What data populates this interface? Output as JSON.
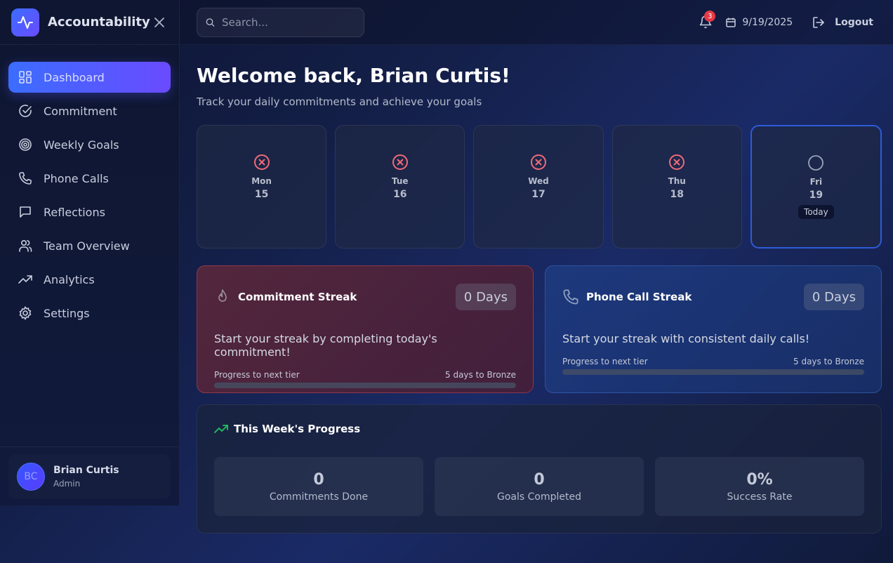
{
  "app": {
    "name": "Accountability"
  },
  "sidebar": {
    "items": [
      {
        "label": "Dashboard",
        "icon": "dashboard-icon",
        "active": true
      },
      {
        "label": "Commitment",
        "icon": "check-circle-icon"
      },
      {
        "label": "Weekly Goals",
        "icon": "target-icon"
      },
      {
        "label": "Phone Calls",
        "icon": "phone-icon"
      },
      {
        "label": "Reflections",
        "icon": "message-icon"
      },
      {
        "label": "Team Overview",
        "icon": "users-icon"
      },
      {
        "label": "Analytics",
        "icon": "trending-up-icon"
      },
      {
        "label": "Settings",
        "icon": "gear-icon"
      }
    ],
    "user": {
      "initials": "BC",
      "name": "Brian Curtis",
      "role": "Admin"
    }
  },
  "header": {
    "search_placeholder": "Search...",
    "notification_count": "3",
    "date": "9/19/2025",
    "logout_label": "Logout"
  },
  "main": {
    "title": "Welcome back, Brian Curtis!",
    "subtitle": "Track your daily commitments and achieve your goals",
    "days": [
      {
        "name": "Mon",
        "num": "15",
        "status": "missed"
      },
      {
        "name": "Tue",
        "num": "16",
        "status": "missed"
      },
      {
        "name": "Wed",
        "num": "17",
        "status": "missed"
      },
      {
        "name": "Thu",
        "num": "18",
        "status": "missed"
      },
      {
        "name": "Fri",
        "num": "19",
        "status": "pending",
        "today_label": "Today"
      }
    ],
    "streaks": {
      "commitment": {
        "title": "Commitment Streak",
        "days": "0 Days",
        "message": "Start your streak by completing today's commitment!",
        "progress_label": "Progress to next tier",
        "progress_target": "5 days to Bronze",
        "progress": 0
      },
      "phone": {
        "title": "Phone Call Streak",
        "days": "0 Days",
        "message": "Start your streak with consistent daily calls!",
        "progress_label": "Progress to next tier",
        "progress_target": "5 days to Bronze",
        "progress": 0
      }
    },
    "week": {
      "title": "This Week's Progress",
      "stats": [
        {
          "value": "0",
          "label": "Commitments Done"
        },
        {
          "value": "0",
          "label": "Goals Completed"
        },
        {
          "value": "0%",
          "label": "Success Rate"
        }
      ]
    }
  },
  "colors": {
    "accent": "#3b6dff",
    "accent2": "#6a4bff",
    "missed": "#f06a78",
    "badge": "#e53945",
    "trend": "#22c55e"
  }
}
